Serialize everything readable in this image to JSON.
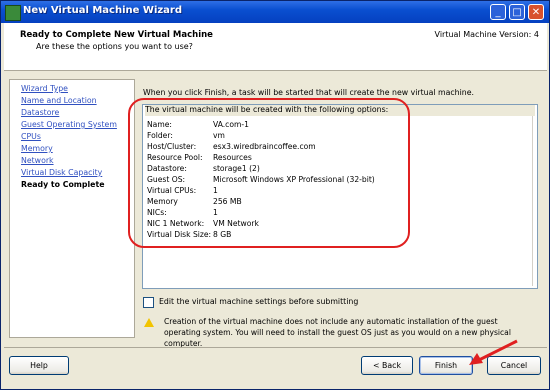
{
  "window": {
    "title": "New Virtual Machine Wizard",
    "controls": {
      "minimize": "_",
      "maximize": "□",
      "close": "✕"
    }
  },
  "header": {
    "title": "Ready to Complete New Virtual Machine",
    "subtitle": "Are these the options you want to use?",
    "version": "Virtual Machine Version: 4"
  },
  "sidebar": {
    "items": [
      {
        "label": "Wizard Type"
      },
      {
        "label": "Name and Location"
      },
      {
        "label": "Datastore"
      },
      {
        "label": "Guest Operating System"
      },
      {
        "label": "CPUs"
      },
      {
        "label": "Memory"
      },
      {
        "label": "Network"
      },
      {
        "label": "Virtual Disk Capacity"
      },
      {
        "label": "Ready to Complete"
      }
    ]
  },
  "main": {
    "intro": "When you click Finish, a task will be started that will create the new virtual machine.",
    "options_caption": "The virtual machine will be created with the following options:",
    "options": [
      {
        "key": "Name:",
        "value": "VA.com-1"
      },
      {
        "key": "Folder:",
        "value": "vm"
      },
      {
        "key": "Host/Cluster:",
        "value": "esx3.wiredbraincoffee.com"
      },
      {
        "key": "Resource Pool:",
        "value": "Resources"
      },
      {
        "key": "Datastore:",
        "value": "storage1 (2)"
      },
      {
        "key": "Guest OS:",
        "value": "Microsoft Windows XP Professional (32-bit)"
      },
      {
        "key": "Virtual CPUs:",
        "value": "1"
      },
      {
        "key": "Memory",
        "value": "256 MB"
      },
      {
        "key": "NICs:",
        "value": "1"
      },
      {
        "key": "NIC 1 Network:",
        "value": "VM Network"
      },
      {
        "key": "Virtual Disk Size:",
        "value": "8 GB"
      }
    ],
    "edit_checkbox_label": "Edit the virtual machine settings before submitting",
    "warning": "Creation of the virtual machine does not include any automatic installation of the guest operating system. You will need to install the guest OS just as you would on a new physical computer."
  },
  "buttons": {
    "help": "Help",
    "back": "< Back",
    "finish": "Finish",
    "cancel": "Cancel"
  },
  "colors": {
    "annotation": "#e02020",
    "link": "#3050c0"
  }
}
